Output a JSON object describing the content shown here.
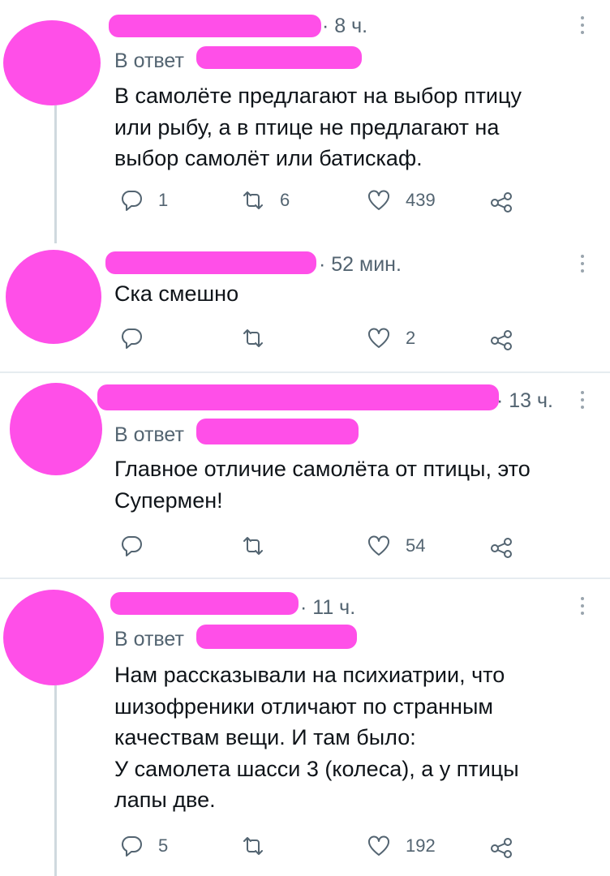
{
  "colors": {
    "redaction": "#ff4fe8",
    "muted": "#536471",
    "text": "#0f1419",
    "divider": "#e6ecf0"
  },
  "icons": [
    "reply-icon",
    "retweet-icon",
    "like-icon",
    "share-icon",
    "more-icon"
  ],
  "tweets": [
    {
      "time": "· 8 ч.",
      "reply_prefix": "В ответ",
      "text": "В самолёте предлагают на выбор птицу\nили рыбу, а в птице не предлагают на\nвыбор самолёт или батискаф.",
      "replies": "1",
      "retweets": "6",
      "likes": "439"
    },
    {
      "time": "· 52 мин.",
      "text": "Ска смешно",
      "replies": "",
      "retweets": "",
      "likes": "2"
    },
    {
      "time": "· 13 ч.",
      "reply_prefix": "В ответ",
      "text": "Главное отличие самолёта от птицы, это\nСупермен!",
      "replies": "",
      "retweets": "",
      "likes": "54"
    },
    {
      "time": "· 11 ч.",
      "reply_prefix": "В ответ",
      "text": "Нам рассказывали на психиатрии, что\nшизофреники отличают по странным\nкачествам вещи. И там было:\nУ самолета шасси 3 (колеса), а у птицы\nлапы две.",
      "replies": "5",
      "retweets": "",
      "likes": "192"
    }
  ]
}
